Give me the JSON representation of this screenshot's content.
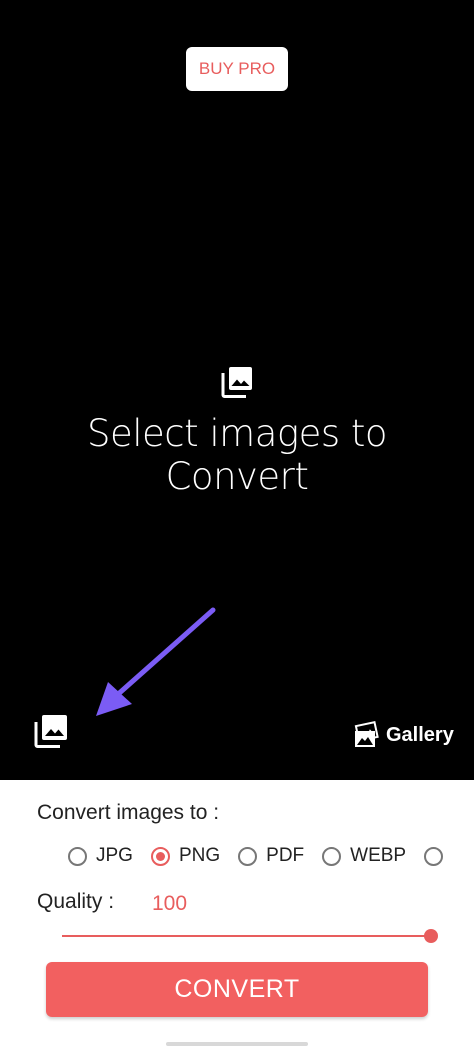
{
  "header": {
    "buy_pro_label": "BUY PRO"
  },
  "picker": {
    "prompt_line1": "Select images to",
    "prompt_line2": "Convert",
    "center_icon": "photo-library-icon",
    "select_icon": "photo-library-icon",
    "gallery_label": "Gallery",
    "gallery_icon": "photos-icon"
  },
  "annotation": {
    "arrow_color": "#7b5cf5"
  },
  "options": {
    "convert_label": "Convert images to :",
    "formats": [
      {
        "label": "JPG",
        "selected": false
      },
      {
        "label": "PNG",
        "selected": true
      },
      {
        "label": "PDF",
        "selected": false
      },
      {
        "label": "WEBP",
        "selected": false
      }
    ],
    "quality_label": "Quality :",
    "quality_value": "100",
    "quality_fraction": 1.0,
    "convert_button": "CONVERT"
  },
  "colors": {
    "accent": "#e85d5d",
    "button": "#f26060"
  }
}
